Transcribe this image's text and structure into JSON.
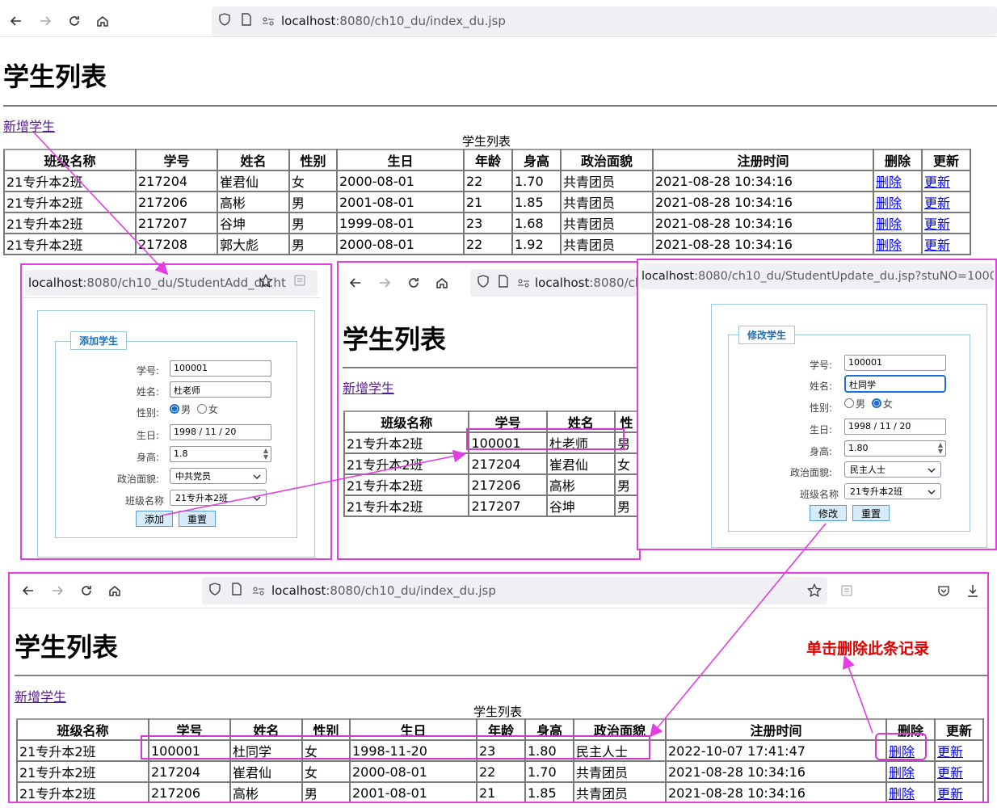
{
  "main": {
    "url": {
      "host": "localhost",
      "rest": ":8080/ch10_du/index_du.jsp"
    },
    "title": "学生列表",
    "add_link": "新增学生",
    "caption": "学生列表",
    "headers": [
      "班级名称",
      "学号",
      "姓名",
      "性别",
      "生日",
      "年龄",
      "身高",
      "政治面貌",
      "注册时间",
      "删除",
      "更新"
    ],
    "rows": [
      [
        "21专升本2班",
        "217204",
        "崔君仙",
        "女",
        "2000-08-01",
        "22",
        "1.70",
        "共青团员",
        "2021-08-28 10:34:16",
        "删除",
        "更新"
      ],
      [
        "21专升本2班",
        "217206",
        "高彬",
        "男",
        "2001-08-01",
        "21",
        "1.85",
        "共青团员",
        "2021-08-28 10:34:16",
        "删除",
        "更新"
      ],
      [
        "21专升本2班",
        "217207",
        "谷坤",
        "男",
        "1999-08-01",
        "23",
        "1.68",
        "共青团员",
        "2021-08-28 10:34:16",
        "删除",
        "更新"
      ],
      [
        "21专升本2班",
        "217208",
        "郭大彪",
        "男",
        "2000-08-01",
        "22",
        "1.92",
        "共青团员",
        "2021-08-28 10:34:16",
        "删除",
        "更新"
      ]
    ]
  },
  "add_window": {
    "url": {
      "host": "localhost",
      "rest": ":8080/ch10_du/StudentAdd_du.ht"
    },
    "legend": "添加学生",
    "labels": {
      "id": "学号:",
      "name": "姓名:",
      "gender": "性别:",
      "birthday": "生日:",
      "height": "身高:",
      "political": "政治面貌:",
      "class": "班级名称"
    },
    "values": {
      "id": "100001",
      "name": "杜老师",
      "birthday": "1998 / 11 / 20",
      "height": "1.8",
      "political": "中共党员",
      "class": "21专升本2班"
    },
    "gender_options": [
      "男",
      "女"
    ],
    "gender_selected": "男",
    "buttons": {
      "submit": "添加",
      "reset": "重置"
    }
  },
  "middle_window": {
    "url": {
      "host": "localhost",
      "rest": ":8080/ch"
    },
    "title": "学生列表",
    "add_link": "新增学生",
    "headers": [
      "班级名称",
      "学号",
      "姓名",
      "性"
    ],
    "rows": [
      [
        "21专升本2班",
        "100001",
        "杜老师",
        "男"
      ],
      [
        "21专升本2班",
        "217204",
        "崔君仙",
        "女"
      ],
      [
        "21专升本2班",
        "217206",
        "高彬",
        "男"
      ],
      [
        "21专升本2班",
        "217207",
        "谷坤",
        "男"
      ]
    ]
  },
  "update_window": {
    "url": {
      "host": "localhost",
      "rest": ":8080/ch10_du/StudentUpdate_du.jsp?stuNO=100001"
    },
    "legend": "修改学生",
    "labels": {
      "id": "学号:",
      "name": "姓名:",
      "gender": "性别:",
      "birthday": "生日:",
      "height": "身高:",
      "political": "政治面貌:",
      "class": "班级名称"
    },
    "values": {
      "id": "100001",
      "name": "杜同学",
      "birthday": "1998 / 11 / 20",
      "height": "1.80",
      "political": "民主人士",
      "class": "21专升本2班"
    },
    "gender_options": [
      "男",
      "女"
    ],
    "gender_selected": "女",
    "buttons": {
      "submit": "修改",
      "reset": "重置"
    }
  },
  "result_window": {
    "url": {
      "host": "localhost",
      "rest": ":8080/ch10_du/index_du.jsp"
    },
    "title": "学生列表",
    "add_link": "新增学生",
    "caption": "学生列表",
    "note": "单击删除此条记录",
    "headers": [
      "班级名称",
      "学号",
      "姓名",
      "性别",
      "生日",
      "年龄",
      "身高",
      "政治面貌",
      "注册时间",
      "删除",
      "更新"
    ],
    "rows": [
      [
        "21专升本2班",
        "100001",
        "杜同学",
        "女",
        "1998-11-20",
        "23",
        "1.80",
        "民主人士",
        "2022-10-07 17:41:47",
        "删除",
        "更新"
      ],
      [
        "21专升本2班",
        "217204",
        "崔君仙",
        "女",
        "2000-08-01",
        "22",
        "1.70",
        "共青团员",
        "2021-08-28 10:34:16",
        "删除",
        "更新"
      ],
      [
        "21专升本2班",
        "217206",
        "高彬",
        "男",
        "2001-08-01",
        "21",
        "1.85",
        "共青团员",
        "2021-08-28 10:34:16",
        "删除",
        "更新"
      ]
    ]
  },
  "colors": {
    "annotation": "#e23ee2",
    "note": "#e00000",
    "link": "#0000ee",
    "visited": "#551a8b",
    "legend": "#1f6fb2"
  }
}
